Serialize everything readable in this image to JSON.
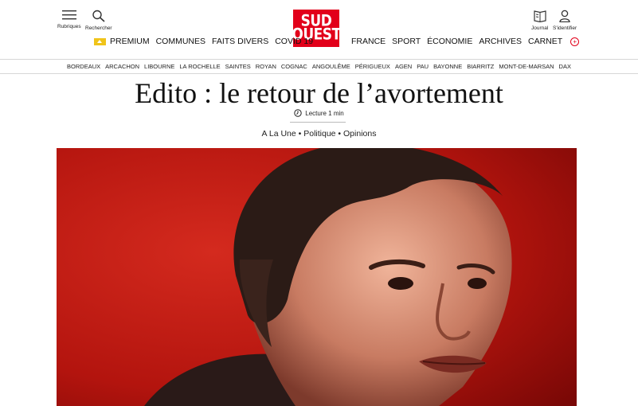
{
  "header": {
    "rubriques_label": "Rubriques",
    "rechercher_label": "Rechercher",
    "journal_label": "Journal",
    "identifier_label": "S'identifier",
    "logo_line1": "SUD",
    "logo_line2": "OUEST",
    "brand_color": "#e2001a"
  },
  "nav_left": [
    "PREMIUM",
    "COMMUNES",
    "FAITS DIVERS",
    "COVID 19"
  ],
  "nav_right": [
    "FRANCE",
    "SPORT",
    "ÉCONOMIE",
    "ARCHIVES",
    "CARNET"
  ],
  "cities": [
    "BORDEAUX",
    "ARCACHON",
    "LIBOURNE",
    "LA ROCHELLE",
    "SAINTES",
    "ROYAN",
    "COGNAC",
    "ANGOULÊME",
    "PÉRIGUEUX",
    "AGEN",
    "PAU",
    "BAYONNE",
    "BIARRITZ",
    "MONT-DE-MARSAN",
    "DAX"
  ],
  "article": {
    "title": "Edito : le retour de l’avortement",
    "read_time": "Lecture 1 min",
    "tags": "A La Une • Politique • Opinions"
  }
}
